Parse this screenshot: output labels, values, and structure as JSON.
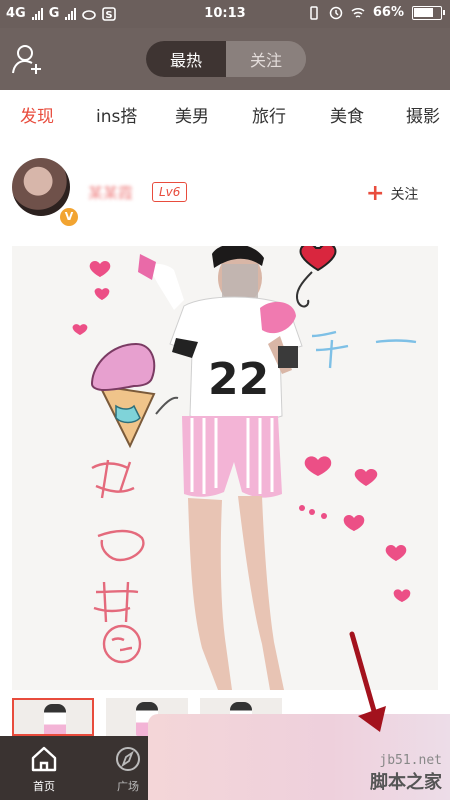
{
  "status_bar": {
    "net1": "4G",
    "net2": "G",
    "time": "10:13",
    "battery": "66%"
  },
  "header": {
    "seg_hot": "最热",
    "seg_follow": "关注"
  },
  "tabs": [
    "发现",
    "ins搭",
    "美男",
    "旅行",
    "美食",
    "摄影"
  ],
  "post": {
    "username": "某某霞",
    "level": "Lv6",
    "verified": "V",
    "follow": "关注"
  },
  "bottom_nav": {
    "home": "首页",
    "square": "广场"
  },
  "watermark": {
    "domain": "jb51.net",
    "brand": "脚本之家"
  },
  "colors": {
    "accent": "#e84c3d",
    "header_bg": "#6e625f",
    "nav_bg": "#3a3331"
  }
}
